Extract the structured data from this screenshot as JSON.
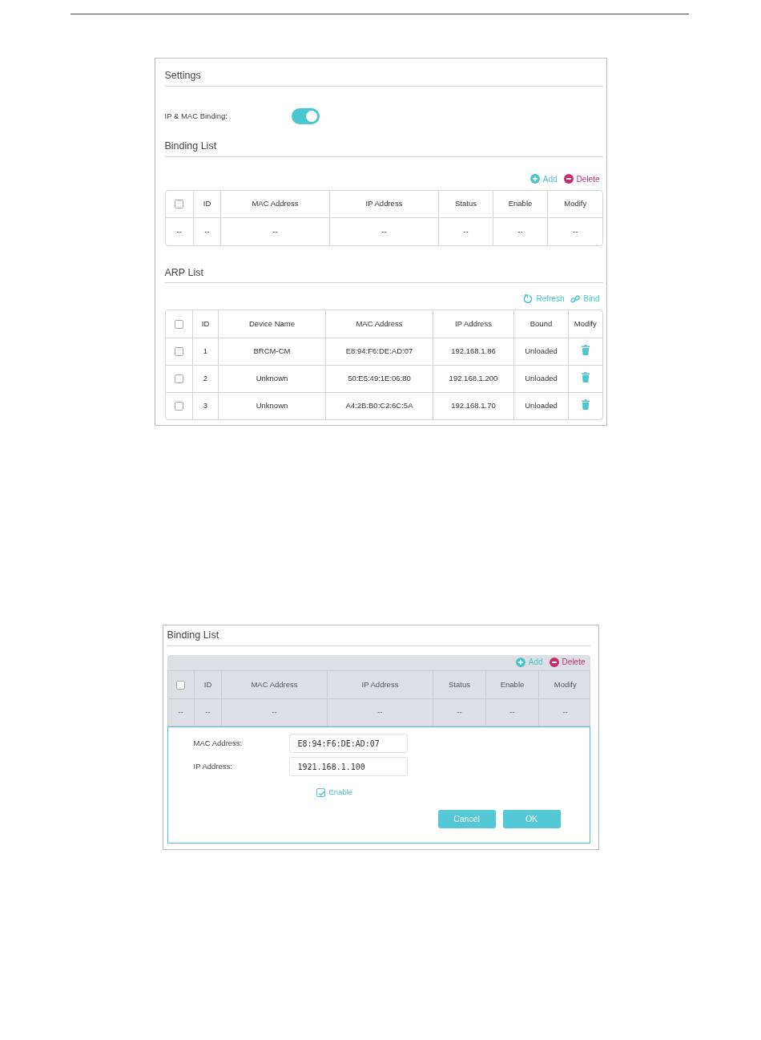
{
  "settings": {
    "title": "Settings",
    "binding_label": "IP & MAC Binding:",
    "binding_on": true
  },
  "binding_list": {
    "title": "Binding List",
    "actions": [
      {
        "kind": "add",
        "label": "Add"
      },
      {
        "kind": "delete",
        "label": "Delete"
      }
    ],
    "select_all_checked": false,
    "columns": [
      "",
      "ID",
      "MAC Address",
      "IP Address",
      "Status",
      "Enable",
      "Modify"
    ],
    "rows": [
      {
        "cells": [
          "--",
          "--",
          "--",
          "--",
          "--",
          "--",
          "--"
        ]
      }
    ]
  },
  "arp_list": {
    "title": "ARP List",
    "actions": [
      {
        "kind": "refresh",
        "label": "Refresh"
      },
      {
        "kind": "bind",
        "label": "Bind"
      }
    ],
    "select_all_checked": false,
    "columns": [
      "",
      "ID",
      "Device Name",
      "MAC Address",
      "IP Address",
      "Bound",
      "Modify"
    ],
    "rows": [
      {
        "checked": false,
        "id": "1",
        "device_name": "BRCM-CM",
        "mac_address": "E8:94:F6:DE:AD:07",
        "ip_address": "192.168.1.86",
        "bound": "Unloaded"
      },
      {
        "checked": false,
        "id": "2",
        "device_name": "Unknown",
        "mac_address": "50:E5:49:1E:06:80",
        "ip_address": "192.168.1.200",
        "bound": "Unloaded"
      },
      {
        "checked": false,
        "id": "3",
        "device_name": "Unknown",
        "mac_address": "A4:2B:B0:C2:6C:5A",
        "ip_address": "192.168.1.70",
        "bound": "Unloaded"
      }
    ]
  },
  "add_entry": {
    "title": "Binding List",
    "dimmed": true,
    "actions": [
      {
        "kind": "add",
        "label": "Add"
      },
      {
        "kind": "delete",
        "label": "Delete"
      }
    ],
    "select_all_checked": false,
    "columns": [
      "",
      "ID",
      "MAC Address",
      "IP Address",
      "Status",
      "Enable",
      "Modify"
    ],
    "rows": [
      {
        "cells": [
          "--",
          "--",
          "--",
          "--",
          "--",
          "--",
          "--"
        ]
      }
    ],
    "form": {
      "fields": [
        {
          "label": "MAC Address:",
          "value": "E8:94:F6:DE:AD:07"
        },
        {
          "label": "IP Address:",
          "value": "1921.168.1.100"
        }
      ],
      "enable": {
        "label": "Enable",
        "checked": true
      },
      "buttons": [
        "Cancel",
        "OK"
      ]
    }
  }
}
